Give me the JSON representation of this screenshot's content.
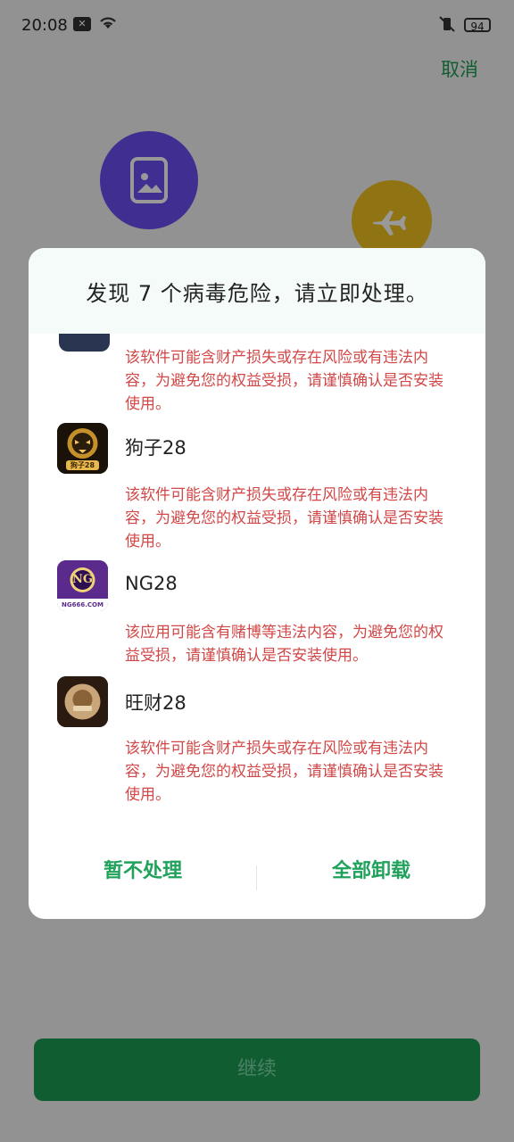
{
  "status": {
    "time": "20:08",
    "battery": "94"
  },
  "header": {
    "cancel_label": "取消"
  },
  "bottom": {
    "continue_label": "继续"
  },
  "dialog": {
    "title": "发现 7 个病毒危险，请立即处理。",
    "items": [
      {
        "name": "",
        "warning": "该软件可能含财产损失或存在风险或有违法内容，为避免您的权益受损，请谨慎确认是否安装使用。"
      },
      {
        "name": "狗子28",
        "icon": "tiger-app-icon",
        "icon_text": "狗子28",
        "warning": "该软件可能含财产损失或存在风险或有违法内容，为避免您的权益受损，请谨慎确认是否安装使用。"
      },
      {
        "name": "NG28",
        "icon": "ng-app-icon",
        "icon_text": "NG",
        "icon_subtext": "NG666.COM",
        "warning": "该应用可能含有赌博等违法内容，为避免您的权益受损，请谨慎确认是否安装使用。"
      },
      {
        "name": "旺财28",
        "icon": "wangcai-app-icon",
        "warning": "该软件可能含财产损失或存在风险或有违法内容，为避免您的权益受损，请谨慎确认是否安装使用。"
      }
    ],
    "actions": {
      "ignore_label": "暂不处理",
      "uninstall_all_label": "全部卸载"
    }
  },
  "colors": {
    "accent_green": "#1e9b54",
    "warning_red": "#d24747"
  }
}
